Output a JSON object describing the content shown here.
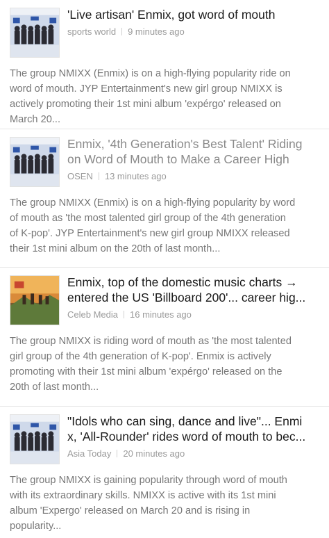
{
  "articles": [
    {
      "title": "'Live artisan' Enmix, got word of mouth",
      "source": "sports world",
      "time": "9 minutes ago",
      "visited": false,
      "thumb_icon": "group-photo-thumbnail",
      "snippet_lines": [
        "The group NMIXX (Enmix) is on a high-flying popularity ride on",
        "word of mouth. JYP Entertainment's new girl group NMIXX is",
        "actively promoting their 1st mini album 'expérgo' released on",
        "March 20..."
      ]
    },
    {
      "title_lines": [
        "Enmix, '4th Generation's Best Talent' Riding",
        "on Word of Mouth to Make a Career High"
      ],
      "source": "OSEN",
      "time": "13 minutes ago",
      "visited": true,
      "thumb_icon": "group-photo-thumbnail",
      "snippet_lines": [
        "The group NMIXX (Enmix) is on a high-flying popularity by word",
        "of mouth as 'the most talented girl group of the 4th generation",
        "of K-pop'. JYP Entertainment's new girl group NMIXX released",
        "their 1st mini album on the 20th of last month..."
      ]
    },
    {
      "title_lines": [
        "Enmix, top of the domestic music charts →",
        "entered the US 'Billboard 200'... career hig..."
      ],
      "source": "Celeb Media",
      "time": "16 minutes ago",
      "visited": false,
      "thumb_icon": "album-art-thumbnail",
      "snippet_lines": [
        "The group NMIXX is riding word of mouth as 'the most talented",
        "girl group of the 4th generation of K-pop'. Enmix is actively",
        "promoting with their 1st mini album 'expérgo' released on the",
        "20th of last month..."
      ]
    },
    {
      "title_lines": [
        "\"Idols who can sing, dance and live\"... Enmi",
        "x, 'All-Rounder' rides word of mouth to bec..."
      ],
      "source": "Asia Today",
      "time": "20 minutes ago",
      "visited": false,
      "thumb_icon": "group-photo-thumbnail",
      "snippet_lines": [
        "The group NMIXX is gaining popularity through word of mouth",
        "with its extraordinary skills. NMIXX is active with its 1st mini",
        "album 'Expergo' released on March 20 and is rising in",
        "popularity..."
      ]
    }
  ]
}
